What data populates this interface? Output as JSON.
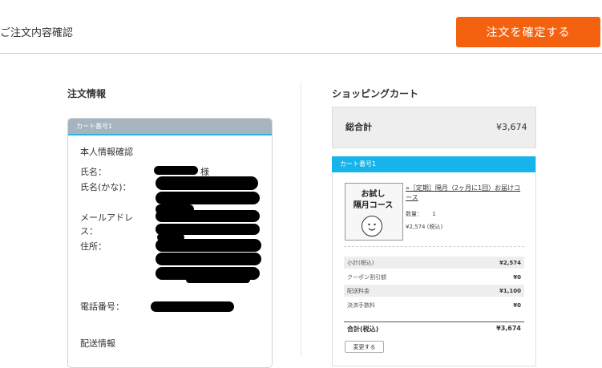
{
  "header": {
    "page_title": "ご注文内容確認",
    "confirm_button": "注文を確定する",
    "accent_color": "#f5620f"
  },
  "order_info": {
    "title": "注文情報",
    "card_label": "カート番号1",
    "personal_title": "本人情報確認",
    "labels": {
      "name": "氏名：",
      "name_kana": "氏名(かな)：",
      "email_line1": "メールアドレ",
      "email_line2": "ス：",
      "address": "住所：",
      "phone": "電話番号："
    },
    "honorific": "様",
    "delivery_title": "配送情報"
  },
  "cart": {
    "title": "ショッピングカート",
    "total_label": "総合計",
    "total_value": "¥3,674",
    "card_label": "カート番号1",
    "product": {
      "thumb_text_line1": "お試し",
      "thumb_text_line2": "隔月コース",
      "name": "»［定期］隔月（2ヶ月に1回）お届けコース",
      "qty_label": "数量：",
      "qty_value": "1",
      "price": "¥2,574 (税込)"
    },
    "summary": [
      {
        "label": "小計(税込)",
        "value": "¥2,574"
      },
      {
        "label": "クーポン割引額",
        "value": "¥0"
      },
      {
        "label": "配送料金",
        "value": "¥1,100"
      },
      {
        "label": "決済手数料",
        "value": "¥0"
      }
    ],
    "grand_label": "合計(税込)",
    "grand_value": "¥3,674",
    "change_button": "変更する",
    "header_color": "#16b4ea"
  }
}
